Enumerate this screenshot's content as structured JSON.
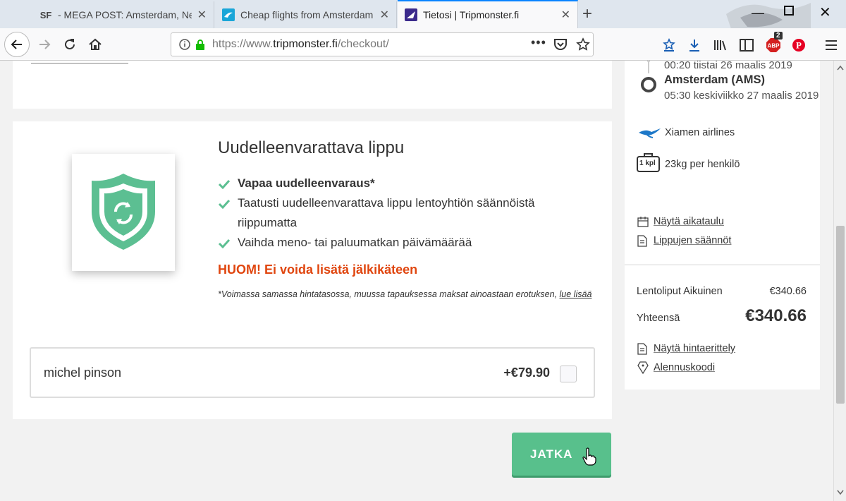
{
  "browser": {
    "tabs": [
      {
        "favicon": "SF",
        "title": "- MEGA POST: Amsterdam, Netherlands"
      },
      {
        "favicon": "plane",
        "title": "Cheap flights from Amsterdam"
      },
      {
        "favicon": "tm",
        "title": "Tietosi | Tripmonster.fi"
      }
    ],
    "url": {
      "protocol": "https://www.",
      "host": "tripmonster.fi",
      "path": "/checkout/"
    },
    "addon_badge": "2"
  },
  "flight": {
    "departure_time": "00:20 tiistai 26 maalis 2019",
    "arrival_city": "Amsterdam (AMS)",
    "arrival_time": "05:30 keskiviikko 27 maalis 2019",
    "airline": "Xiamen airlines",
    "baggage_count": "1 kpl",
    "baggage_text": "23kg per henkilö",
    "schedule_link": "Näytä aikataulu",
    "rules_link": "Lippujen säännöt"
  },
  "pricing": {
    "line_label": "Lentoliput Aikuinen",
    "line_price": "€340.66",
    "total_label": "Yhteensä",
    "total_price": "€340.66",
    "breakdown_link": "Näytä hintaerittely",
    "discount_link": "Alennuskoodi"
  },
  "offer": {
    "title": "Uudelleenvarattava lippu",
    "features": [
      "Vapaa uudelleenvaraus*",
      "Taatusti uudelleenvarattava lippu lentoyhtiön säännöistä riippumatta",
      "Vaihda meno- tai paluumatkan päivämäärää"
    ],
    "warning": "HUOM! Ei voida lisätä jälkikäteen",
    "note": "*Voimassa samassa hintatasossa, muussa tapauksessa maksat ainoastaan erotuksen,",
    "note_link": "lue lisää"
  },
  "passenger": {
    "name": "michel pinson",
    "price": "+€79.90"
  },
  "continue_label": "JATKA",
  "colors": {
    "accent": "#58c08c",
    "warning": "#e0460f",
    "tab_accent": "#0a84ff"
  }
}
